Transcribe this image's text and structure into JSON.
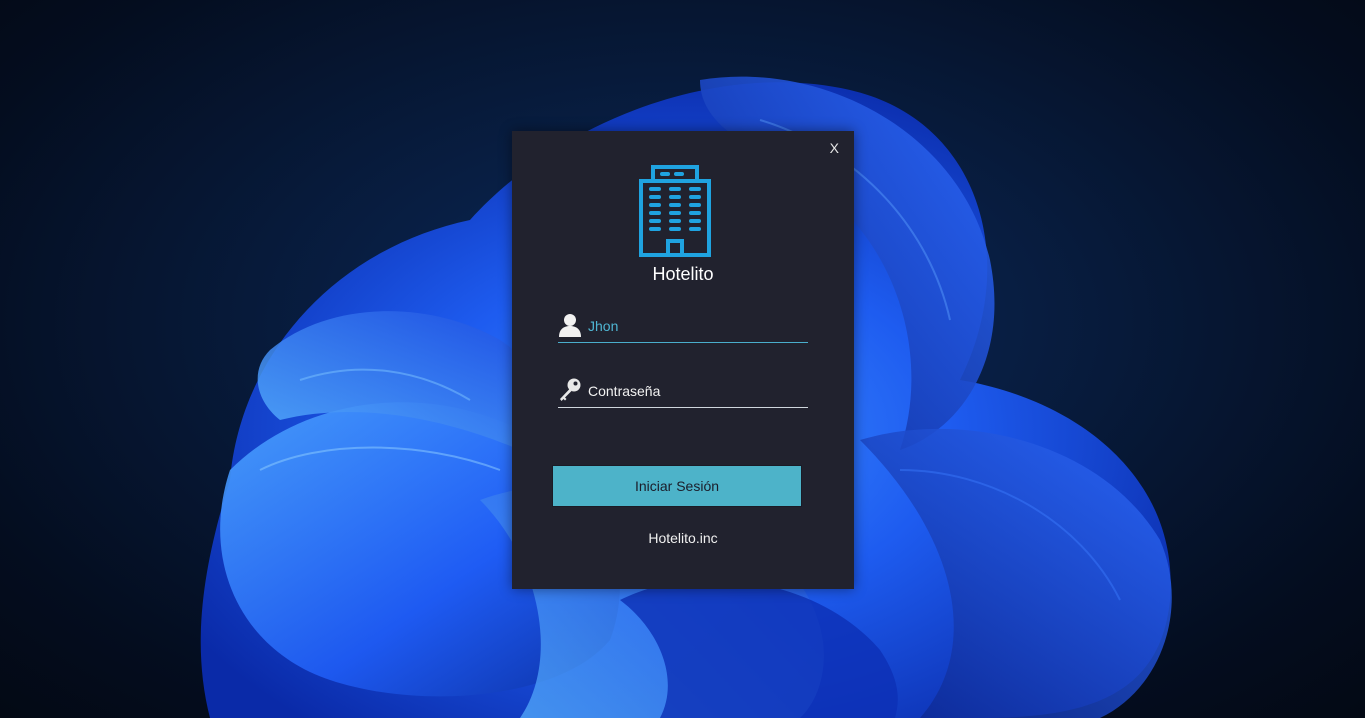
{
  "window": {
    "close_label": "X"
  },
  "app": {
    "title": "Hotelito",
    "logo_icon": "building-icon",
    "accent_color": "#1fa3e0"
  },
  "form": {
    "username": {
      "value": "Jhon",
      "icon": "user-icon"
    },
    "password": {
      "value": "Contraseña",
      "icon": "key-icon"
    },
    "submit_label": "Iniciar Sesión"
  },
  "footer": {
    "text": "Hotelito.inc"
  }
}
